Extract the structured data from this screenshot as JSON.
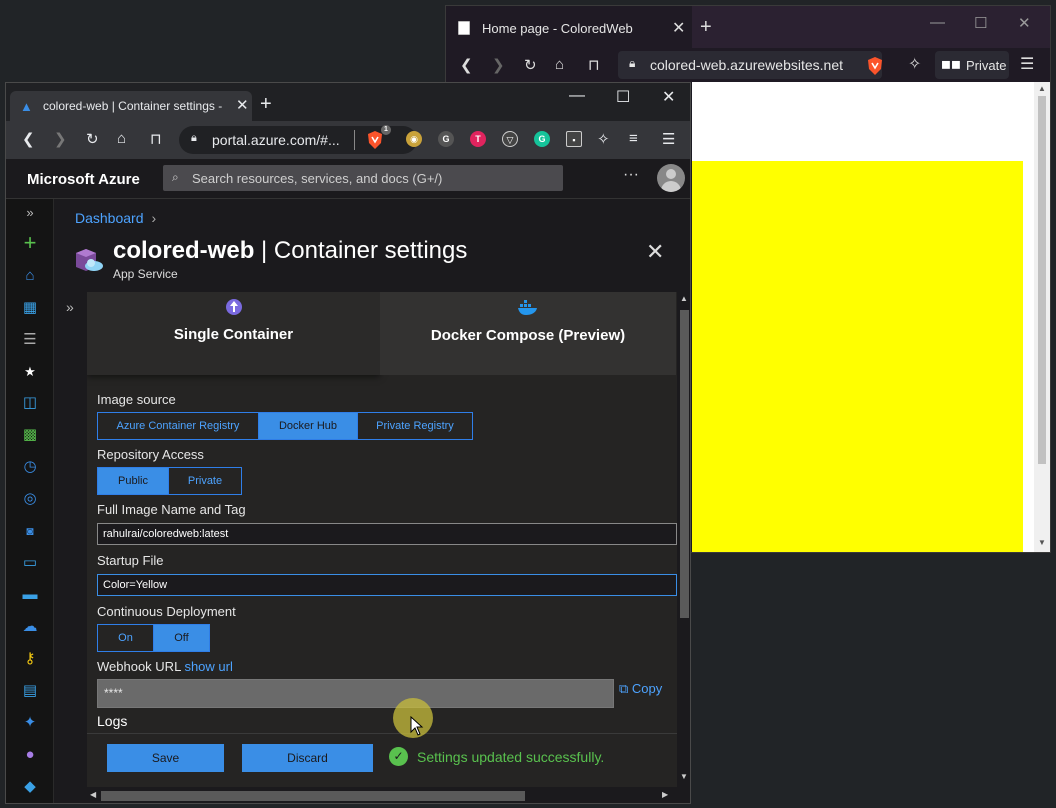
{
  "bg_browser": {
    "tab_title": "Home page - ColoredWeb",
    "url": "colored-web.azurewebsites.net",
    "private_label": "Private",
    "page_color": "#ffff00"
  },
  "front_browser": {
    "tab_title": "colored-web | Container settings -",
    "url": "portal.azure.com/#..."
  },
  "azure": {
    "brand": "Microsoft Azure",
    "search_placeholder": "Search resources, services, and docs (G+/)",
    "breadcrumb": "Dashboard",
    "resource_name": "colored-web",
    "page_title_rest": " | Container settings",
    "resource_type": "App Service",
    "tabs": [
      {
        "label": "Single Container"
      },
      {
        "label": "Docker Compose (Preview)"
      }
    ],
    "image_source": {
      "label": "Image source",
      "options": [
        "Azure Container Registry",
        "Docker Hub",
        "Private Registry"
      ],
      "selected": "Docker Hub"
    },
    "repo_access": {
      "label": "Repository Access",
      "options": [
        "Public",
        "Private"
      ],
      "selected": "Public"
    },
    "image_name": {
      "label": "Full Image Name and Tag",
      "value": "rahulrai/coloredweb:latest"
    },
    "startup_file": {
      "label": "Startup File",
      "value": "Color=Yellow"
    },
    "continuous_deployment": {
      "label": "Continuous Deployment",
      "options": [
        "On",
        "Off"
      ],
      "selected": "Off"
    },
    "webhook": {
      "label": "Webhook URL",
      "show_url": "show url",
      "value": "****",
      "copy": "Copy"
    },
    "logs_title": "Logs",
    "save": "Save",
    "discard": "Discard",
    "status": "Settings updated successfully."
  },
  "accent_color": "#3a8ee6",
  "success_color": "#59c14e"
}
